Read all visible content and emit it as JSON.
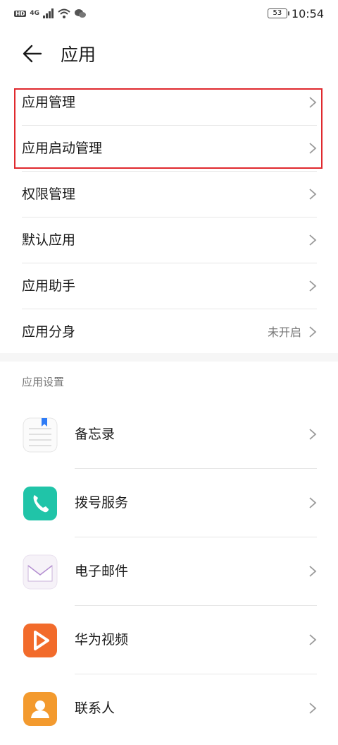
{
  "statusbar": {
    "network": "4G",
    "hd": "HD",
    "battery": "53",
    "time": "10:54"
  },
  "header": {
    "title": "应用"
  },
  "menu": [
    {
      "label": "应用管理"
    },
    {
      "label": "应用启动管理"
    },
    {
      "label": "权限管理"
    },
    {
      "label": "默认应用"
    },
    {
      "label": "应用助手"
    },
    {
      "label": "应用分身",
      "value": "未开启"
    }
  ],
  "app_settings": {
    "section_title": "应用设置",
    "apps": [
      {
        "label": "备忘录",
        "icon": "notes-icon"
      },
      {
        "label": "拨号服务",
        "icon": "phone-icon"
      },
      {
        "label": "电子邮件",
        "icon": "email-icon"
      },
      {
        "label": "华为视频",
        "icon": "video-icon"
      },
      {
        "label": "联系人",
        "icon": "contacts-icon"
      }
    ]
  },
  "colors": {
    "highlight": "#e0292e",
    "phone": "#20c4a8",
    "video": "#f26b2b",
    "contacts": "#f39a2e"
  }
}
